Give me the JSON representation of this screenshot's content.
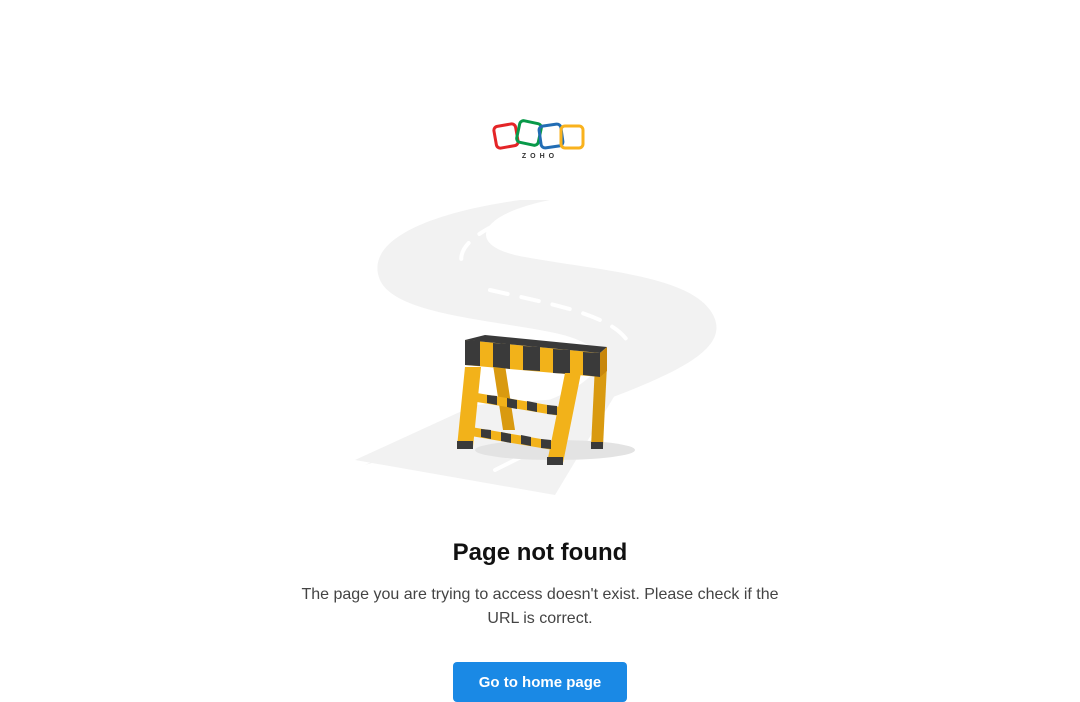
{
  "brand": {
    "logo_text": "ZOHO",
    "colors": {
      "red": "#e42527",
      "green": "#089949",
      "blue": "#226db4",
      "yellow": "#f9b21d"
    }
  },
  "illustration": {
    "icon": "road-barricade-illustration"
  },
  "error": {
    "title": "Page not found",
    "message": "The page you are trying to access doesn't exist. Please check if the URL is correct."
  },
  "actions": {
    "home_label": "Go to home page",
    "button_color": "#1a89e5"
  }
}
